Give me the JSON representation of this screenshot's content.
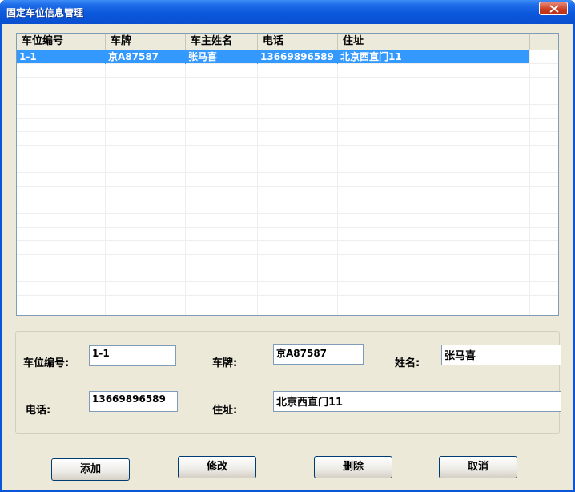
{
  "window": {
    "title": "固定车位信息管理"
  },
  "table": {
    "columns": [
      "车位编号",
      "车牌",
      "车主姓名",
      "电话",
      "住址"
    ],
    "rows": [
      {
        "id": "1-1",
        "plate": "京A87587",
        "owner": "张马喜",
        "phone": "13669896589",
        "address": "北京西直门11",
        "selected": true
      }
    ]
  },
  "form": {
    "labels": {
      "space_no": "车位编号:",
      "plate": "车牌:",
      "name": "姓名:",
      "phone": "电话:",
      "address": "住址:"
    },
    "values": {
      "space_no": "1-1",
      "plate": "京A87587",
      "name": "张马喜",
      "phone": "13669896589",
      "address": "北京西直门11"
    }
  },
  "buttons": {
    "add": "添加",
    "edit": "修改",
    "delete": "删除",
    "cancel": "取消"
  },
  "colors": {
    "title_bar": "#0a56d8",
    "selection": "#3399ff",
    "dialog_bg": "#ece9d8"
  }
}
